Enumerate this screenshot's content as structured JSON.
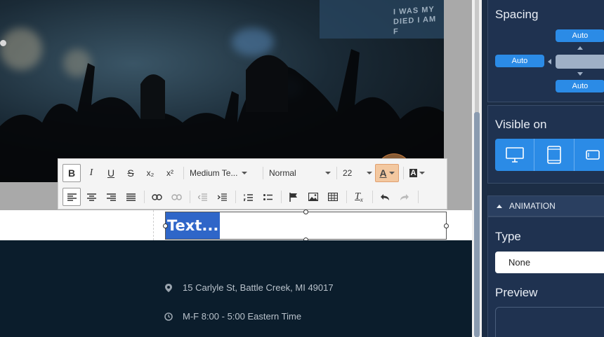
{
  "hero": {
    "screen_text_line1": "I WAS MY",
    "screen_text_line2": "DIED I AM F"
  },
  "editor": {
    "selected_text": "Text...",
    "toolbar": {
      "row1": {
        "bold": "B",
        "italic": "I",
        "underline": "U",
        "strike": "S",
        "subscript": "x₂",
        "superscript": "x²",
        "font_family": "Medium Te...",
        "format": "Normal",
        "font_size": "22",
        "text_color": "A",
        "bg_color": "A"
      }
    }
  },
  "footer": {
    "address": "15 Carlyle St, Battle Creek, MI 49017",
    "hours": "M-F 8:00 - 5:00 Eastern Time"
  },
  "panel": {
    "spacing": {
      "title": "Spacing",
      "top": "Auto",
      "left": "Auto",
      "bottom": "Auto"
    },
    "visible_on": {
      "title": "Visible on",
      "devices": [
        "desktop-icon",
        "tablet-icon",
        "mobile-icon"
      ]
    },
    "animation": {
      "header": "ANIMATION",
      "type_label": "Type",
      "type_value": "None",
      "preview_label": "Preview"
    }
  },
  "colors": {
    "accent": "#2b8be6",
    "panel_bg": "#1c2d45",
    "selection": "#2f66c8",
    "highlight": "#f0a05a"
  }
}
